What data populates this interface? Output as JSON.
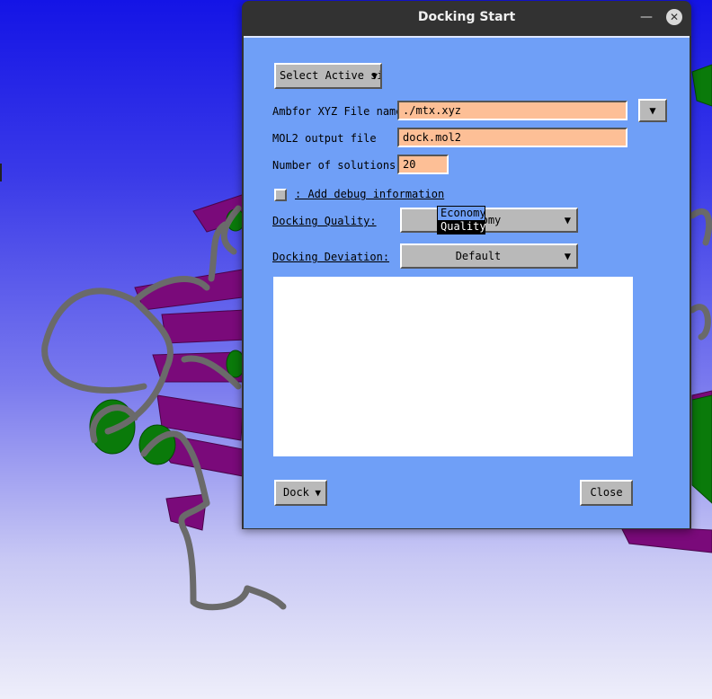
{
  "window": {
    "title": "Docking Start"
  },
  "buttons": {
    "select_active_site": "Select Active site",
    "dock": "Dock",
    "close": "Close"
  },
  "fields": {
    "ambfor_label": "Ambfor XYZ File name:",
    "ambfor_value": "./mtx.xyz",
    "mol2_label": "MOL2 output file    :",
    "mol2_value": "dock.mol2",
    "solutions_label": "Number of solutions :",
    "solutions_value": "20"
  },
  "debug": {
    "label": ": Add debug information",
    "checked": false
  },
  "quality": {
    "label": "Docking Quality:",
    "value": "Economy",
    "options": [
      "Economy",
      "Quality"
    ]
  },
  "deviation": {
    "label": "Docking Deviation:",
    "value": "Default"
  },
  "colors": {
    "panel": "#6f9ff7",
    "input_bg": "#fdbf96",
    "button": "#b9b9b9",
    "titlebar": "#323232",
    "strand": "#7a0a7a",
    "helix": "#0a7a0a",
    "coil": "#6e6e6e"
  }
}
